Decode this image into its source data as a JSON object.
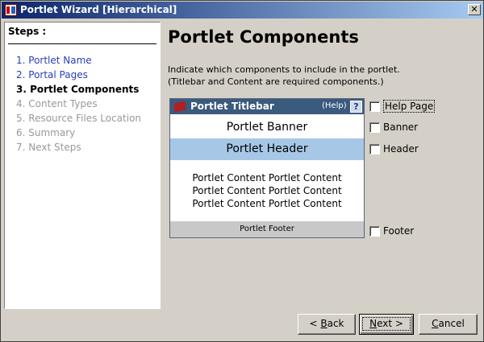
{
  "window": {
    "title": "Portlet Wizard [Hierarchical]",
    "close_glyph": "✕"
  },
  "steps": {
    "header": "Steps :",
    "items": [
      {
        "label": "1. Portlet Name",
        "state": "done"
      },
      {
        "label": "2. Portal Pages",
        "state": "done"
      },
      {
        "label": "3. Portlet Components",
        "state": "current"
      },
      {
        "label": "4. Content Types",
        "state": "future"
      },
      {
        "label": "5. Resource Files Location",
        "state": "future"
      },
      {
        "label": "6. Summary",
        "state": "future"
      },
      {
        "label": "7. Next Steps",
        "state": "future"
      }
    ]
  },
  "main": {
    "title": "Portlet Components",
    "description_line1": "Indicate which components to include in the portlet.",
    "description_line2": "(Titlebar and Content are required components.)"
  },
  "preview": {
    "titlebar": "Portlet Titlebar",
    "help": "(Help)",
    "help_icon": "?",
    "banner": "Portlet Banner",
    "header": "Portlet Header",
    "content_lines": [
      "Portlet Content Portlet Content",
      "Portlet Content Portlet Content",
      "Portlet Content Portlet Content"
    ],
    "footer": "Portlet Footer"
  },
  "options": {
    "help_page": {
      "label": "Help Page",
      "checked": false
    },
    "banner": {
      "label": "Banner",
      "checked": false
    },
    "header": {
      "label": "Header",
      "checked": false
    },
    "footer": {
      "label": "Footer",
      "checked": false
    }
  },
  "buttons": {
    "back": {
      "mnemonic": "B",
      "rest": "ack",
      "prefix": "< "
    },
    "next": {
      "mnemonic": "N",
      "rest": "ext",
      "suffix": " >"
    },
    "cancel": {
      "mnemonic": "C",
      "rest": "ancel"
    }
  },
  "colors": {
    "titlebar_start": "#0a246a",
    "titlebar_end": "#a6caf0",
    "step_done": "#2a40b8",
    "portlet_titlebar": "#3a5a7e",
    "portlet_header": "#a6c8e6"
  }
}
